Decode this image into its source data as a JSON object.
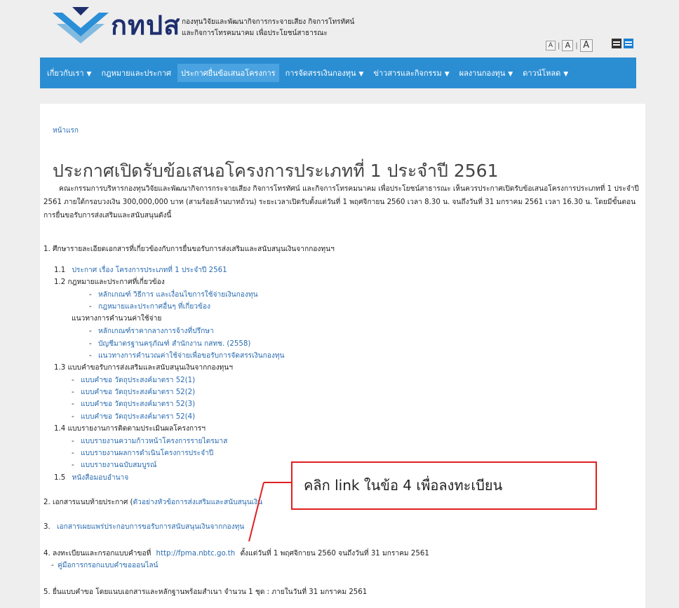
{
  "header": {
    "logo_text": "กทปส",
    "org_line1": "กองทุนวิจัยและพัฒนากิจการกระจายเสียง กิจการโทรทัศน์",
    "org_line2": "และกิจการโทรคมนาคม เพื่อประโยชน์สาธารณะ",
    "font_sizes": [
      "A",
      "A",
      "A"
    ],
    "font_separator": "|",
    "view_icons": [
      "list-dark-icon",
      "list-blue-icon"
    ]
  },
  "nav": {
    "items": [
      {
        "label": "เกี่ยวกับเรา",
        "caret": "▼"
      },
      {
        "label": "กฎหมายและประกาศ",
        "caret": ""
      },
      {
        "label": "ประกาศยื่นข้อเสนอโครงการ",
        "caret": ""
      },
      {
        "label": "การจัดสรรเงินกองทุน",
        "caret": "▼"
      },
      {
        "label": "ข่าวสารและกิจกรรม",
        "caret": "▼"
      },
      {
        "label": "ผลงานกองทุน",
        "caret": "▼"
      },
      {
        "label": "ดาวน์โหลด",
        "caret": "▼"
      }
    ]
  },
  "content": {
    "breadcrumb": "หน้าแรก",
    "title": "ประกาศเปิดรับข้อเสนอโครงการประเภทที่ 1 ประจำปี 2561",
    "intro": "คณะกรรมการบริหารกองทุนวิจัยและพัฒนากิจการกระจายเสียง กิจการโทรทัศน์ และกิจการโทรคมนาคม เพื่อประโยชน์สาธารณะ เห็นควรประกาศเปิดรับข้อเสนอโครงการประเภทที่ 1 ประจำปี 2561 ภายใต้กรอบวงเงิน 300,000,000 บาท (สามร้อยล้านบาทถ้วน) ระยะเวลาเปิดรับตั้งแต่วันที่ 1 พฤศจิกายน 2560 เวลา 8.30 น. จนถึงวันที่ 31 มกราคม 2561 เวลา 16.30 น. โดยมีขั้นตอนการยื่นขอรับการส่งเสริมและสนับสนุนดังนี้",
    "s1_heading": "1.  ศึกษารายละเอียดเอกสารที่เกี่ยวข้องกับการยื่นขอรับการส่งเสริมและสนับสนุนเงินจากกองทุนฯ",
    "s1_1_num": "1.1",
    "s1_1_link": "ประกาศ เรื่อง โครงการประเภทที่ 1 ประจำปี 2561",
    "s1_2": "1.2  กฎหมายและประกาศที่เกี่ยวข้อง",
    "s1_2_a": "หลักเกณฑ์ วิธีการ และเงื่อนไขการใช้จ่ายเงินกองทุน",
    "s1_2_b": "กฎหมายและประกาศอื่นๆ ที่เกี่ยวข้อง",
    "s1_2_guide": "แนวทางการคำนวนค่าใช้จ่าย",
    "s1_2_c": "หลักเกณฑ์ราคากลางการจ้างที่ปรึกษา",
    "s1_2_d": "บัญชีมาตรฐานครุภัณฑ์ สำนักงาน กสทช. (2558)",
    "s1_2_e": "แนวทางการคำนวณค่าใช้จ่ายเพื่อขอรับการจัดสรรเงินกองทุน",
    "s1_3": "1.3  แบบคำขอรับการส่งเสริมและสนับสนุนเงินจากกองทุนฯ",
    "s1_3_a": "แบบคำขอ วัตถุประสงค์มาตรา 52(1)",
    "s1_3_b": "แบบคำขอ วัตถุประสงค์มาตรา 52(2)",
    "s1_3_c": "แบบคำขอ วัตถุประสงค์มาตรา 52(3)",
    "s1_3_d": "แบบคำขอ วัตถุประสงค์มาตรา 52(4)",
    "s1_4": "1.4  แบบรายงานการติดตามประเมินผลโครงการฯ",
    "s1_4_a": "แบบรายงานความก้าวหน้าโครงการรายไตรมาส",
    "s1_4_b": "แบบรายงานผลการดำเนินโครงการประจำปี",
    "s1_4_c": "แบบรายงานฉบับสมบูรณ์",
    "s1_5_num": "1.5",
    "s1_5_link": "หนังสือมอบอำนาจ",
    "dash": "-",
    "s2_text": "2.  เอกสารแนบท้ายประกาศ (",
    "s2_link": "ตัวอย่างหัวข้อการส่งเสริมและสนับสนุนเงิน",
    "s3_num": "3.",
    "s3_link": "เอกสารเผยแพร่ประกอบการขอรับการสนับสนุนเงินจากกองทุน",
    "s4_text": "4.  ลงทะเบียนและกรอกแบบคำขอที่",
    "s4_link": "http://fpma.nbtc.go.th",
    "s4_text2": "ตั้งแต่วันที่ 1 พฤศจิกายน 2560 จนถึงวันที่ 31 มกราคม 2561",
    "s4_sub_link": "คู่มือการกรอกแบบคำขอออนไลน์",
    "s5_text": "5.  ยื่นแบบคำขอ โดยแนบเอกสารและหลักฐานพร้อมสำเนา จำนวน 1 ชุด : ภายในวันที่ 31 มกราคม 2561"
  },
  "callout": {
    "text": "คลิก link ในข้อ 4 เพื่อลงทะเบียน",
    "border_color": "#e02020"
  },
  "colors": {
    "nav_bg": "#2b8ed3",
    "nav_active": "#4aa3e0",
    "link": "#2b6cb0",
    "logo": "#1f2f6e",
    "logo_mark": "#2a8fd6"
  }
}
